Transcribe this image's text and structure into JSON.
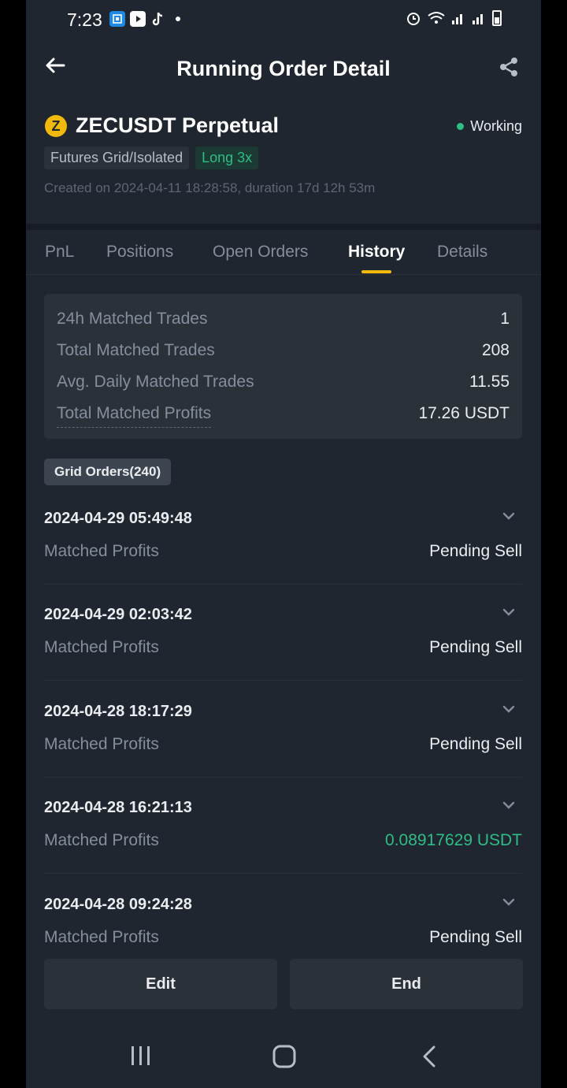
{
  "status_bar": {
    "time": "7:23"
  },
  "header": {
    "title": "Running Order Detail"
  },
  "order": {
    "pair": "ZECUSDT Perpetual",
    "coin_letter": "Z",
    "status": "Working",
    "tags": [
      "Futures Grid/Isolated",
      "Long 3x"
    ],
    "created": "Created on 2024-04-11 18:28:58, duration 17d 12h 53m"
  },
  "tabs": [
    "PnL",
    "Positions",
    "Open Orders",
    "History",
    "Details"
  ],
  "active_tab": "History",
  "summary": [
    {
      "label": "24h Matched Trades",
      "value": "1"
    },
    {
      "label": "Total Matched Trades",
      "value": "208"
    },
    {
      "label": "Avg. Daily Matched Trades",
      "value": "11.55"
    },
    {
      "label": "Total Matched Profits",
      "value": "17.26 USDT"
    }
  ],
  "grid_orders_label": "Grid Orders(240)",
  "orders": [
    {
      "time": "2024-04-29 05:49:48",
      "label": "Matched Profits",
      "value": "Pending Sell"
    },
    {
      "time": "2024-04-29 02:03:42",
      "label": "Matched Profits",
      "value": "Pending Sell"
    },
    {
      "time": "2024-04-28 18:17:29",
      "label": "Matched Profits",
      "value": "Pending Sell"
    },
    {
      "time": "2024-04-28 16:21:13",
      "label": "Matched Profits",
      "value": "0.08917629 USDT"
    },
    {
      "time": "2024-04-28 09:24:28",
      "label": "Matched Profits",
      "value": "Pending Sell"
    }
  ],
  "buttons": {
    "edit": "Edit",
    "end": "End"
  },
  "colors": {
    "accent": "#f0b90b",
    "positive": "#2ebd85",
    "background": "#1f2630",
    "card": "#2b3139"
  },
  "icons": [
    "back-arrow-icon",
    "share-icon",
    "chevron-down-icon",
    "recents-icon",
    "home-icon",
    "back-icon"
  ]
}
